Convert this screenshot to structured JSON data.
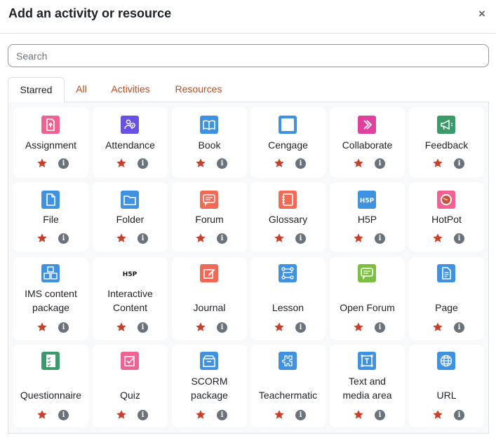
{
  "dialog": {
    "title": "Add an activity or resource",
    "close_glyph": "×",
    "search_placeholder": "Search"
  },
  "tabs": [
    {
      "label": "Starred",
      "active": true
    },
    {
      "label": "All",
      "active": false
    },
    {
      "label": "Activities",
      "active": false
    },
    {
      "label": "Resources",
      "active": false
    }
  ],
  "colors": {
    "star": "#c8402a",
    "info": "#6a737b",
    "tab_link": "#c44b1a",
    "assessment": "#f06292",
    "collaboration": "#6951e1",
    "content": "#3e92e0",
    "communication": "#f26a55",
    "interactive": "#e0409f",
    "admin": "#399b6a"
  },
  "items": [
    {
      "label": "Assignment",
      "icon": "assignment-icon"
    },
    {
      "label": "Attendance",
      "icon": "attendance-icon"
    },
    {
      "label": "Book",
      "icon": "book-icon"
    },
    {
      "label": "Cengage",
      "icon": "cengage-icon"
    },
    {
      "label": "Collaborate",
      "icon": "collaborate-icon"
    },
    {
      "label": "Feedback",
      "icon": "feedback-icon"
    },
    {
      "label": "File",
      "icon": "file-icon"
    },
    {
      "label": "Folder",
      "icon": "folder-icon"
    },
    {
      "label": "Forum",
      "icon": "forum-icon"
    },
    {
      "label": "Glossary",
      "icon": "glossary-icon"
    },
    {
      "label": "H5P",
      "icon": "h5p-icon"
    },
    {
      "label": "HotPot",
      "icon": "hotpot-icon"
    },
    {
      "label_lines": [
        "IMS content",
        "package"
      ],
      "icon": "ims-package-icon"
    },
    {
      "label_lines": [
        "Interactive",
        "Content"
      ],
      "icon": "interactive-content-icon"
    },
    {
      "label": "Journal",
      "icon": "journal-icon"
    },
    {
      "label": "Lesson",
      "icon": "lesson-icon"
    },
    {
      "label": "Open Forum",
      "icon": "open-forum-icon"
    },
    {
      "label": "Page",
      "icon": "page-icon"
    },
    {
      "label": "Questionnaire",
      "icon": "questionnaire-icon"
    },
    {
      "label": "Quiz",
      "icon": "quiz-icon"
    },
    {
      "label_lines": [
        "SCORM",
        "package"
      ],
      "icon": "scorm-icon"
    },
    {
      "label": "Teachermatic",
      "icon": "teachermatic-icon"
    },
    {
      "label_lines": [
        "Text and",
        "media area"
      ],
      "icon": "text-media-icon"
    },
    {
      "label": "URL",
      "icon": "url-icon"
    }
  ],
  "star_label": "★",
  "info_glyph": "i",
  "h5p_text": "H5P"
}
